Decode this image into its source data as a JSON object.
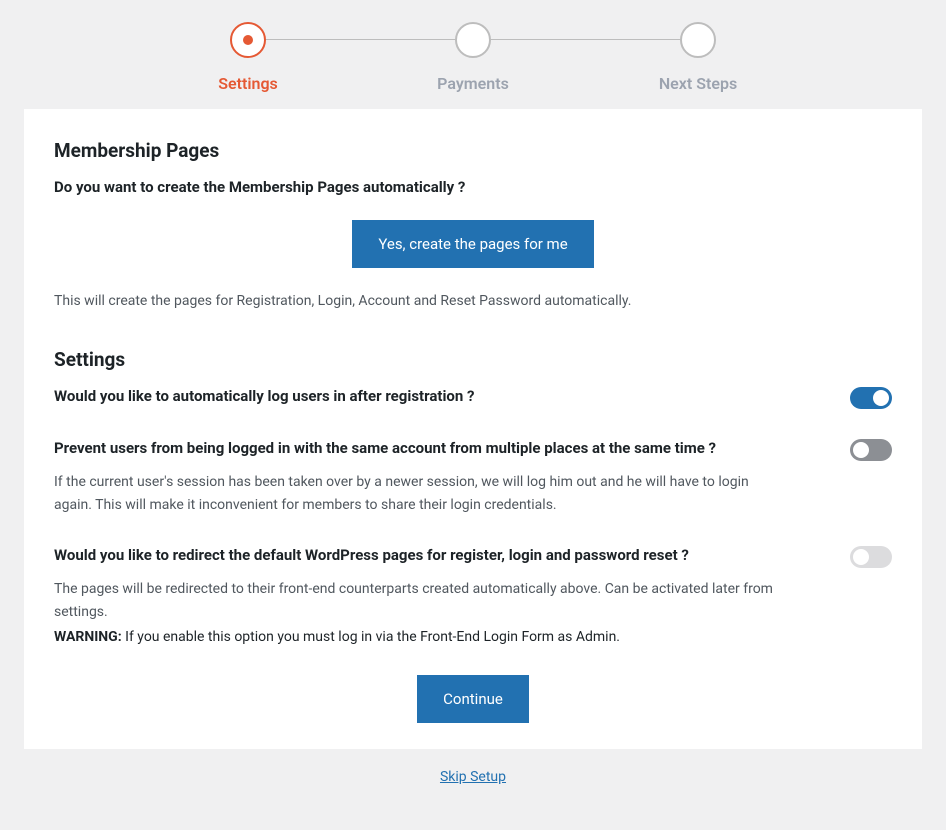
{
  "stepper": {
    "steps": [
      {
        "label": "Settings",
        "active": true
      },
      {
        "label": "Payments",
        "active": false
      },
      {
        "label": "Next Steps",
        "active": false
      }
    ]
  },
  "membership": {
    "heading": "Membership Pages",
    "question": "Do you want to create the Membership Pages automatically ?",
    "button": "Yes, create the pages for me",
    "help": "This will create the pages for Registration, Login, Account and Reset Password automatically."
  },
  "settings": {
    "heading": "Settings",
    "autologin": {
      "label": "Would you like to automatically log users in after registration ?",
      "value": true
    },
    "prevent_multi": {
      "label": "Prevent users from being logged in with the same account from multiple places at the same time ?",
      "value": false,
      "help": "If the current user's session has been taken over by a newer session, we will log him out and he will have to login again. This will make it inconvenient for members to share their login credentials."
    },
    "redirect": {
      "label": "Would you like to redirect the default WordPress pages for register, login and password reset ?",
      "value": false,
      "help": "The pages will be redirected to their front-end counterparts created automatically above. Can be activated later from settings.",
      "warning_label": "WARNING:",
      "warning_text": " If you enable this option you must log in via the Front-End Login Form as Admin."
    }
  },
  "actions": {
    "continue": "Continue",
    "skip": "Skip Setup"
  }
}
